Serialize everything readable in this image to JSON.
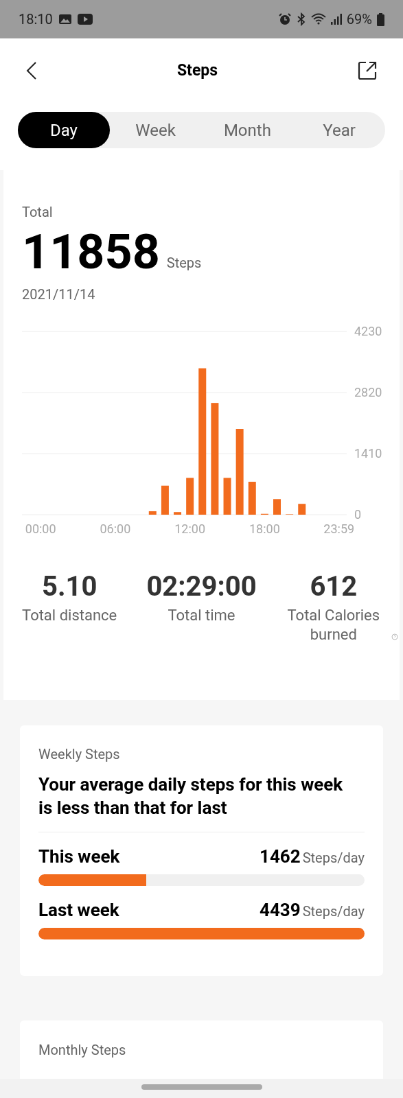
{
  "status_bar": {
    "time": "18:10",
    "battery": "69%"
  },
  "header": {
    "title": "Steps"
  },
  "tabs": [
    {
      "label": "Day",
      "selected": true
    },
    {
      "label": "Week",
      "selected": false
    },
    {
      "label": "Month",
      "selected": false
    },
    {
      "label": "Year",
      "selected": false
    }
  ],
  "summary": {
    "label": "Total",
    "value": "11858",
    "unit": "Steps",
    "date": "2021/11/14",
    "chart_data": {
      "type": "bar",
      "x": [
        0,
        1,
        2,
        3,
        4,
        5,
        6,
        7,
        8,
        9,
        10,
        11,
        12,
        13,
        14,
        15,
        16,
        17,
        18,
        19,
        20,
        21,
        22,
        23
      ],
      "values": [
        0,
        0,
        0,
        0,
        0,
        0,
        0,
        0,
        0,
        80,
        670,
        60,
        850,
        3380,
        2580,
        850,
        1980,
        760,
        20,
        360,
        10,
        250,
        0,
        0
      ],
      "xlim": [
        -1.5,
        24.6
      ],
      "ylim": [
        0,
        4230
      ],
      "yticks": [
        0,
        1410,
        2820,
        4230
      ],
      "xticks": [
        {
          "value": 0,
          "label": "00:00"
        },
        {
          "value": 6,
          "label": "06:00"
        },
        {
          "value": 12,
          "label": "12:00"
        },
        {
          "value": 18,
          "label": "18:00"
        },
        {
          "value": 23.98,
          "label": "23:59"
        }
      ]
    },
    "metrics": [
      {
        "value": "5.10",
        "label": "Total distance"
      },
      {
        "value": "02:29:00",
        "label": "Total time"
      },
      {
        "value": "612",
        "label": "Total Calories burned"
      }
    ]
  },
  "weekly": {
    "title": "Weekly Steps",
    "headline": "Your average daily steps for this week is less than that for last",
    "rows": [
      {
        "label": "This week",
        "value": "1462",
        "unit": "Steps/day",
        "level": 0.33
      },
      {
        "label": "Last week",
        "value": "4439",
        "unit": "Steps/day",
        "level": 1
      }
    ]
  },
  "monthly": {
    "title": "Monthly Steps"
  }
}
